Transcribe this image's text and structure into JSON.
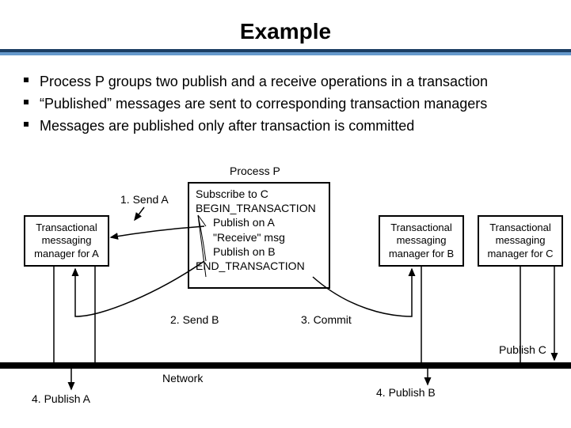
{
  "title": "Example",
  "bullets": [
    "Process P groups two publish and a receive operations in a transaction",
    "“Published” messages are sent to corresponding transaction managers",
    "Messages are published only after  transaction is committed"
  ],
  "diagram": {
    "procP_label": "Process P",
    "procP_lines": {
      "l1": "Subscribe to C",
      "l2": "BEGIN_TRANSACTION",
      "l3": "Publish on A",
      "l4": "\"Receive\" msg",
      "l5": "Publish on B",
      "l6": "END_TRANSACTION"
    },
    "boxA": "Transactional\nmessaging\nmanager for A",
    "boxB": "Transactional\nmessaging\nmanager for B",
    "boxC": "Transactional\nmessaging\nmanager for C",
    "sendA": "1. Send A",
    "sendB": "2. Send B",
    "commit": "3. Commit",
    "publishA": "4. Publish A",
    "publishB": "4. Publish B",
    "publishC": "Publish C",
    "network": "Network"
  }
}
